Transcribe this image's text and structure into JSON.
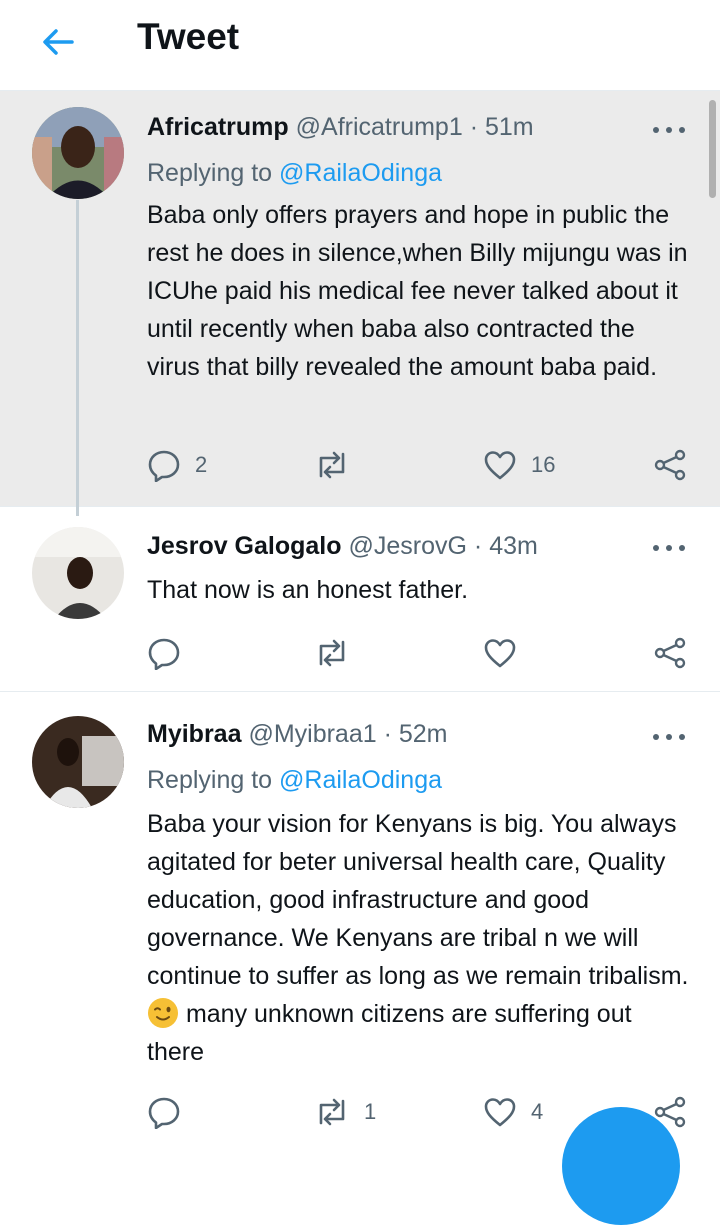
{
  "header": {
    "title": "Tweet"
  },
  "tweets": [
    {
      "name": "Africatrump",
      "handle": "@Africatrump1",
      "separator": "·",
      "time": "51m",
      "replying_prefix": "Replying to",
      "replying_to": "@RailaOdinga",
      "text": "Baba only offers prayers and hope in public the rest he does in silence,when Billy mijungu was in ICUhe paid his medical fee never talked about it until recently when baba also contracted the virus that billy revealed the amount baba paid.",
      "reply_count": "2",
      "retweet_count": "",
      "like_count": "16"
    },
    {
      "name": "Jesrov Galogalo",
      "handle": "@JesrovG",
      "separator": "·",
      "time": "43m",
      "text": "That now is an honest father.",
      "reply_count": "",
      "retweet_count": "",
      "like_count": ""
    },
    {
      "name": "Myibraa",
      "handle": "@Myibraa1",
      "separator": "·",
      "time": "52m",
      "replying_prefix": "Replying to",
      "replying_to": "@RailaOdinga",
      "text_before_emoji": "Baba your vision for Kenyans is big. You always agitated for beter universal health care, Quality education, good infrastructure and good governance. We Kenyans are tribal n we will continue to suffer as long as we remain tribalism.",
      "emoji": "winking-face",
      "text_after_emoji": " many unknown citizens are suffering out there",
      "reply_count": "",
      "retweet_count": "1",
      "like_count": "4"
    }
  ],
  "colors": {
    "accent": "#1d9bf0",
    "highlight_bg": "#ebebeb",
    "muted_text": "#536471",
    "icon": "#536471"
  },
  "icons": [
    "back-arrow-icon",
    "more-icon",
    "reply-icon",
    "retweet-icon",
    "like-icon",
    "share-icon",
    "compose-icon"
  ]
}
